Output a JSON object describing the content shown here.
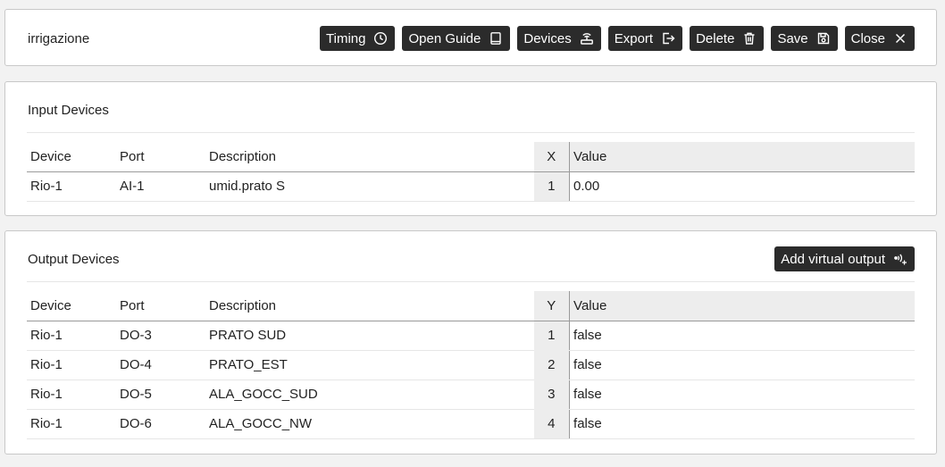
{
  "header": {
    "title": "irrigazione",
    "buttons": [
      {
        "label": "Timing",
        "icon": "clock-icon"
      },
      {
        "label": "Open Guide",
        "icon": "book-icon"
      },
      {
        "label": "Devices",
        "icon": "devices-icon"
      },
      {
        "label": "Export",
        "icon": "export-icon"
      },
      {
        "label": "Delete",
        "icon": "trash-icon"
      },
      {
        "label": "Save",
        "icon": "floppy-icon"
      },
      {
        "label": "Close",
        "icon": "close-icon"
      }
    ]
  },
  "input_devices": {
    "title": "Input Devices",
    "columns": {
      "device": "Device",
      "port": "Port",
      "description": "Description",
      "index": "X",
      "value": "Value"
    },
    "rows": [
      {
        "device": "Rio-1",
        "port": "AI-1",
        "description": "umid.prato S",
        "index": "1",
        "value": "0.00"
      }
    ]
  },
  "output_devices": {
    "title": "Output Devices",
    "add_button": {
      "label": "Add virtual output",
      "icon": "virtual-output-icon"
    },
    "columns": {
      "device": "Device",
      "port": "Port",
      "description": "Description",
      "index": "Y",
      "value": "Value"
    },
    "rows": [
      {
        "device": "Rio-1",
        "port": "DO-3",
        "description": "PRATO SUD",
        "index": "1",
        "value": "false"
      },
      {
        "device": "Rio-1",
        "port": "DO-4",
        "description": "PRATO_EST",
        "index": "2",
        "value": "false"
      },
      {
        "device": "Rio-1",
        "port": "DO-5",
        "description": "ALA_GOCC_SUD",
        "index": "3",
        "value": "false"
      },
      {
        "device": "Rio-1",
        "port": "DO-6",
        "description": "ALA_GOCC_NW",
        "index": "4",
        "value": "false"
      }
    ]
  }
}
